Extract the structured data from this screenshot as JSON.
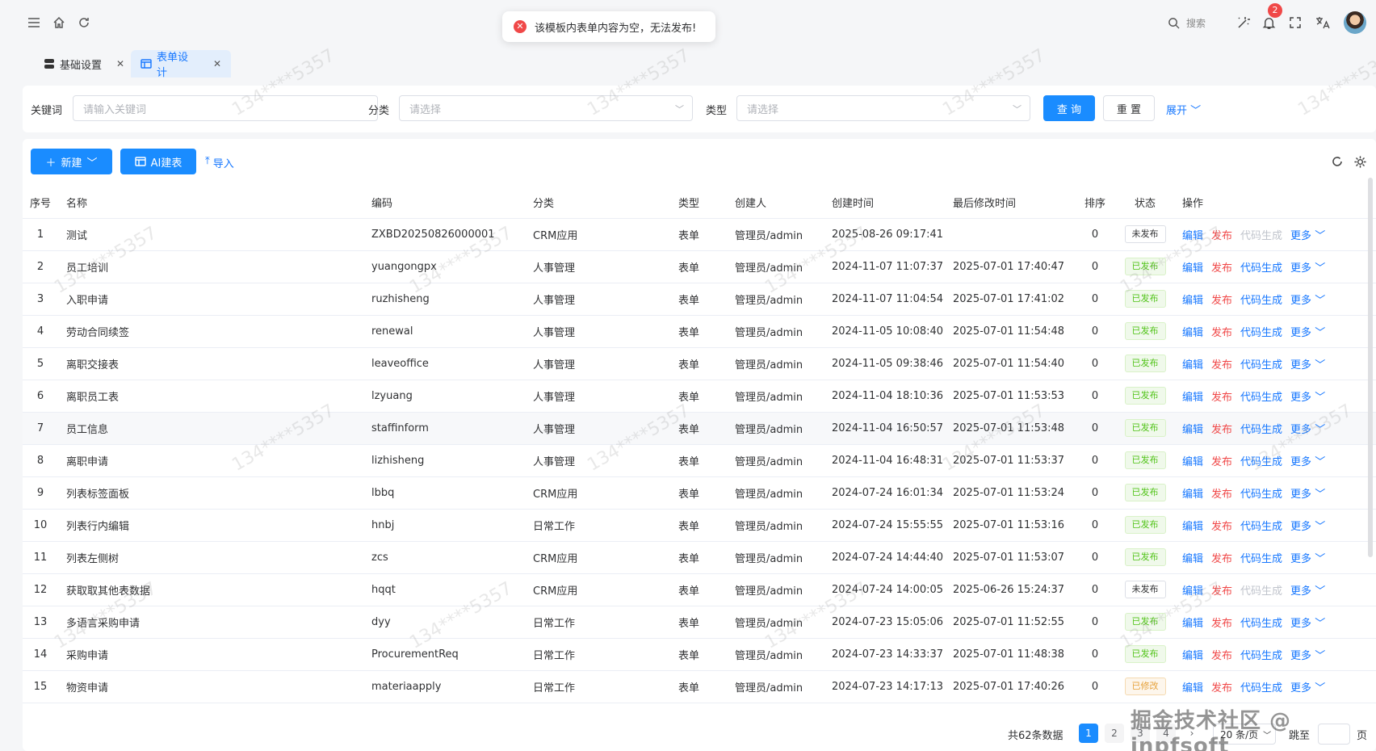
{
  "toast": {
    "message": "该模板内表单内容为空，无法发布!"
  },
  "topbar": {
    "search_label": "搜索",
    "notification_count": "2"
  },
  "tabs": [
    {
      "label": "基础设置"
    },
    {
      "label": "表单设计"
    }
  ],
  "filter": {
    "keyword_label": "关键词",
    "keyword_placeholder": "请输入关键词",
    "category_label": "分类",
    "category_placeholder": "请选择",
    "type_label": "类型",
    "type_placeholder": "请选择",
    "query_label": "查 询",
    "reset_label": "重 置",
    "expand_label": "展开"
  },
  "toolbar": {
    "new_label": "新建",
    "ai_label": "AI建表",
    "import_label": "导入"
  },
  "table": {
    "headers": [
      "序号",
      "名称",
      "编码",
      "分类",
      "类型",
      "创建人",
      "创建时间",
      "最后修改时间",
      "排序",
      "状态",
      "操作"
    ],
    "actions": {
      "edit": "编辑",
      "publish": "发布",
      "code": "代码生成",
      "more": "更多"
    },
    "rows": [
      {
        "no": "1",
        "name": "测试",
        "code": "ZXBD20250826000001",
        "category": "CRM应用",
        "type": "表单",
        "creator": "管理员/admin",
        "created": "2025-08-26 09:17:41",
        "modified": "",
        "sort": "0",
        "status": "未发布",
        "status_kind": "unpub"
      },
      {
        "no": "2",
        "name": "员工培训",
        "code": "yuangongpx",
        "category": "人事管理",
        "type": "表单",
        "creator": "管理员/admin",
        "created": "2024-11-07 11:07:37",
        "modified": "2025-07-01 17:40:47",
        "sort": "0",
        "status": "已发布",
        "status_kind": "pub"
      },
      {
        "no": "3",
        "name": "入职申请",
        "code": "ruzhisheng",
        "category": "人事管理",
        "type": "表单",
        "creator": "管理员/admin",
        "created": "2024-11-07 11:04:54",
        "modified": "2025-07-01 17:41:02",
        "sort": "0",
        "status": "已发布",
        "status_kind": "pub"
      },
      {
        "no": "4",
        "name": "劳动合同续签",
        "code": "renewal",
        "category": "人事管理",
        "type": "表单",
        "creator": "管理员/admin",
        "created": "2024-11-05 10:08:40",
        "modified": "2025-07-01 11:54:48",
        "sort": "0",
        "status": "已发布",
        "status_kind": "pub"
      },
      {
        "no": "5",
        "name": "离职交接表",
        "code": "leaveoffice",
        "category": "人事管理",
        "type": "表单",
        "creator": "管理员/admin",
        "created": "2024-11-05 09:38:46",
        "modified": "2025-07-01 11:54:40",
        "sort": "0",
        "status": "已发布",
        "status_kind": "pub"
      },
      {
        "no": "6",
        "name": "离职员工表",
        "code": "lzyuang",
        "category": "人事管理",
        "type": "表单",
        "creator": "管理员/admin",
        "created": "2024-11-04 18:10:36",
        "modified": "2025-07-01 11:53:53",
        "sort": "0",
        "status": "已发布",
        "status_kind": "pub"
      },
      {
        "no": "7",
        "name": "员工信息",
        "code": "staffinform",
        "category": "人事管理",
        "type": "表单",
        "creator": "管理员/admin",
        "created": "2024-11-04 16:50:57",
        "modified": "2025-07-01 11:53:48",
        "sort": "0",
        "status": "已发布",
        "status_kind": "pub"
      },
      {
        "no": "8",
        "name": "离职申请",
        "code": "lizhisheng",
        "category": "人事管理",
        "type": "表单",
        "creator": "管理员/admin",
        "created": "2024-11-04 16:48:31",
        "modified": "2025-07-01 11:53:37",
        "sort": "0",
        "status": "已发布",
        "status_kind": "pub"
      },
      {
        "no": "9",
        "name": "列表标签面板",
        "code": "lbbq",
        "category": "CRM应用",
        "type": "表单",
        "creator": "管理员/admin",
        "created": "2024-07-24 16:01:34",
        "modified": "2025-07-01 11:53:24",
        "sort": "0",
        "status": "已发布",
        "status_kind": "pub"
      },
      {
        "no": "10",
        "name": "列表行内编辑",
        "code": "hnbj",
        "category": "日常工作",
        "type": "表单",
        "creator": "管理员/admin",
        "created": "2024-07-24 15:55:55",
        "modified": "2025-07-01 11:53:16",
        "sort": "0",
        "status": "已发布",
        "status_kind": "pub"
      },
      {
        "no": "11",
        "name": "列表左侧树",
        "code": "zcs",
        "category": "CRM应用",
        "type": "表单",
        "creator": "管理员/admin",
        "created": "2024-07-24 14:44:40",
        "modified": "2025-07-01 11:53:07",
        "sort": "0",
        "status": "已发布",
        "status_kind": "pub"
      },
      {
        "no": "12",
        "name": "获取取其他表数据",
        "code": "hqqt",
        "category": "CRM应用",
        "type": "表单",
        "creator": "管理员/admin",
        "created": "2024-07-24 14:00:05",
        "modified": "2025-06-26 15:24:37",
        "sort": "0",
        "status": "未发布",
        "status_kind": "unpub"
      },
      {
        "no": "13",
        "name": "多语言采购申请",
        "code": "dyy",
        "category": "日常工作",
        "type": "表单",
        "creator": "管理员/admin",
        "created": "2024-07-23 15:05:06",
        "modified": "2025-07-01 11:52:55",
        "sort": "0",
        "status": "已发布",
        "status_kind": "pub"
      },
      {
        "no": "14",
        "name": "采购申请",
        "code": "ProcurementReq",
        "category": "日常工作",
        "type": "表单",
        "creator": "管理员/admin",
        "created": "2024-07-23 14:33:37",
        "modified": "2025-07-01 11:48:38",
        "sort": "0",
        "status": "已发布",
        "status_kind": "pub"
      },
      {
        "no": "15",
        "name": "物资申请",
        "code": "materiaapply",
        "category": "日常工作",
        "type": "表单",
        "creator": "管理员/admin",
        "created": "2024-07-23 14:17:13",
        "modified": "2025-07-01 17:40:26",
        "sort": "0",
        "status": "已修改",
        "status_kind": "mod"
      }
    ]
  },
  "pager": {
    "total": "共62条数据",
    "pages": [
      "1",
      "2",
      "3",
      "4"
    ],
    "size": "20 条/页",
    "jump": "跳至",
    "page_suffix": "页"
  },
  "watermark": {
    "text": "134****5357",
    "footer": "掘金技术社区 @ jnpfsoft"
  },
  "colors": {
    "primary": "#1a8cff",
    "danger": "#f04848",
    "success": "#52c41a",
    "warning": "#e6a23c"
  }
}
